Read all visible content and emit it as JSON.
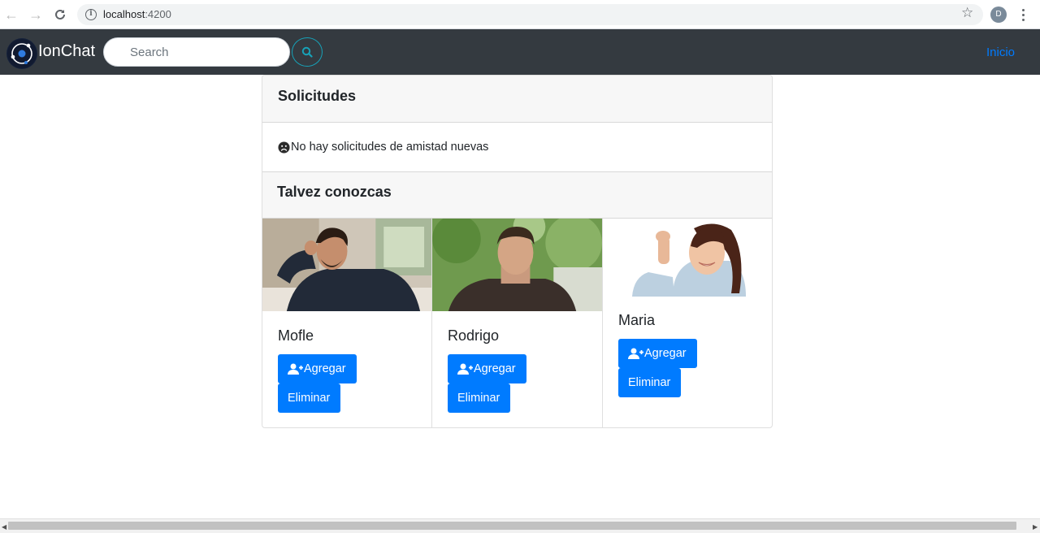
{
  "browser": {
    "url_host": "localhost",
    "url_port": ":4200",
    "profile_initial": "D"
  },
  "navbar": {
    "brand": "IonChat",
    "search_placeholder": "Search",
    "nav_link": "Inicio",
    "accent": "#007bff",
    "bg": "#343a40"
  },
  "requests": {
    "title": "Solicitudes",
    "empty_message": "No hay solicitudes de amistad nuevas"
  },
  "suggestions": {
    "title": "Talvez conozcas",
    "people": [
      {
        "name": "Mofle",
        "add_label": "Agregar",
        "remove_label": "Eliminar"
      },
      {
        "name": "Rodrigo",
        "add_label": "Agregar",
        "remove_label": "Eliminar"
      },
      {
        "name": "Maria",
        "add_label": "Agregar",
        "remove_label": "Eliminar"
      }
    ]
  }
}
